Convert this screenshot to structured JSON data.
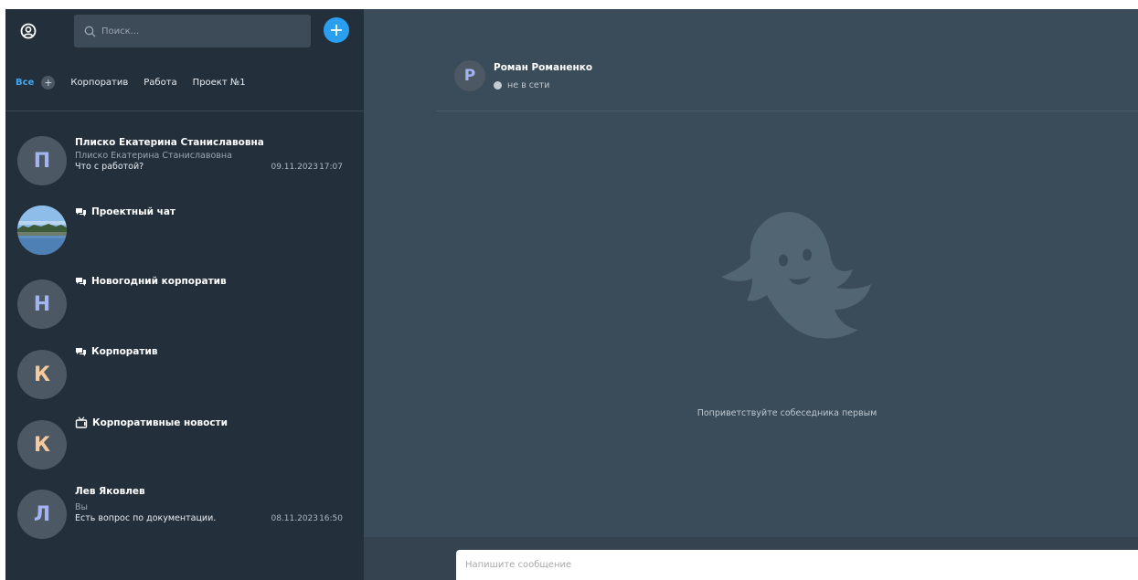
{
  "search": {
    "placeholder": "Поиск..."
  },
  "tabs": {
    "active": "Все",
    "items": [
      "Корпоратив",
      "Работа",
      "Проект №1"
    ]
  },
  "chats": [
    {
      "avatar_letter": "П",
      "title": "Плиско Екатерина Станиславовна",
      "sender": "Плиско Екатерина Станиславовна",
      "message": "Что с работой?",
      "date": "09.11.2023",
      "time": "17:07"
    },
    {
      "avatar_letter": "",
      "title": "Проектный чат",
      "icon": "group-chat-icon"
    },
    {
      "avatar_letter": "Н",
      "title": "Новогодний корпоратив",
      "icon": "group-chat-icon"
    },
    {
      "avatar_letter": "К",
      "title": "Корпоратив",
      "icon": "group-chat-icon"
    },
    {
      "avatar_letter": "К",
      "title": "Корпоративные новости",
      "icon": "channel-icon"
    },
    {
      "avatar_letter": "Л",
      "title": "Лев Яковлев",
      "sender": "Вы",
      "message": "Есть вопрос по документации.",
      "date": "08.11.2023",
      "time": "16:50"
    }
  ],
  "conversation": {
    "avatar_letter": "Р",
    "name": "Роман Романенко",
    "status": "не в сети",
    "empty_text": "Поприветствуйте собеседника первым",
    "input_placeholder": "Напишите сообщение"
  },
  "colors": {
    "sidebar_bg": "#232f3b",
    "main_bg": "#3a4b59",
    "accent": "#2a9ff0",
    "avatar_letter_blue": "#a3b4f0",
    "avatar_letter_orange": "#f7c99f"
  }
}
